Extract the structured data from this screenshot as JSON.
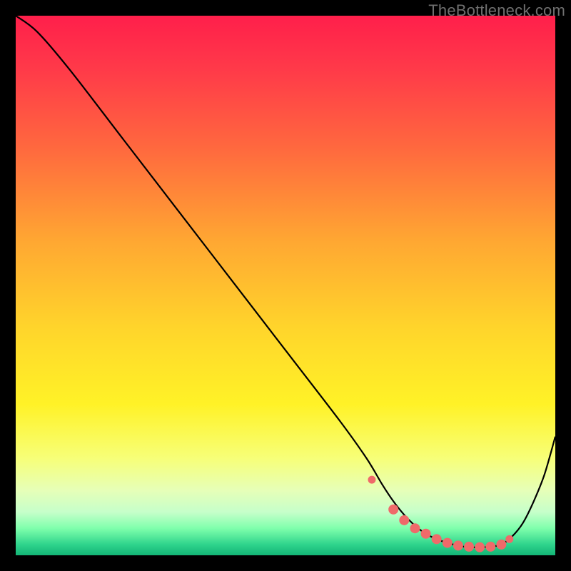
{
  "watermark": "TheBottleneck.com",
  "colors": {
    "background": "#000000",
    "curve_stroke": "#000000",
    "marker_fill": "#ef6a6a",
    "marker_stroke": "#ef6a6a"
  },
  "chart_data": {
    "type": "line",
    "title": "",
    "xlabel": "",
    "ylabel": "",
    "xlim": [
      0,
      100
    ],
    "ylim": [
      0,
      100
    ],
    "x": [
      0,
      4,
      10,
      20,
      30,
      40,
      50,
      60,
      65,
      68,
      70,
      72,
      74,
      76,
      78,
      80,
      82,
      84,
      86,
      88,
      90,
      92,
      94,
      96,
      98,
      100
    ],
    "values": [
      100,
      97,
      90,
      77,
      64,
      51,
      38,
      25,
      18,
      13,
      10,
      7.5,
      5.5,
      4,
      3,
      2.3,
      1.8,
      1.5,
      1.5,
      1.6,
      2,
      3.5,
      6,
      10,
      15,
      22
    ],
    "markers": {
      "x": [
        66,
        70,
        72,
        74,
        76,
        78,
        80,
        82,
        84,
        86,
        88,
        90,
        91.5
      ],
      "y": [
        14,
        8.5,
        6.5,
        5,
        4,
        3,
        2.3,
        1.8,
        1.6,
        1.5,
        1.6,
        2,
        3
      ],
      "size": [
        5,
        6.5,
        6.5,
        6.5,
        6.5,
        6.5,
        6.5,
        6.5,
        6.5,
        6.5,
        6.5,
        6.5,
        5
      ]
    }
  }
}
